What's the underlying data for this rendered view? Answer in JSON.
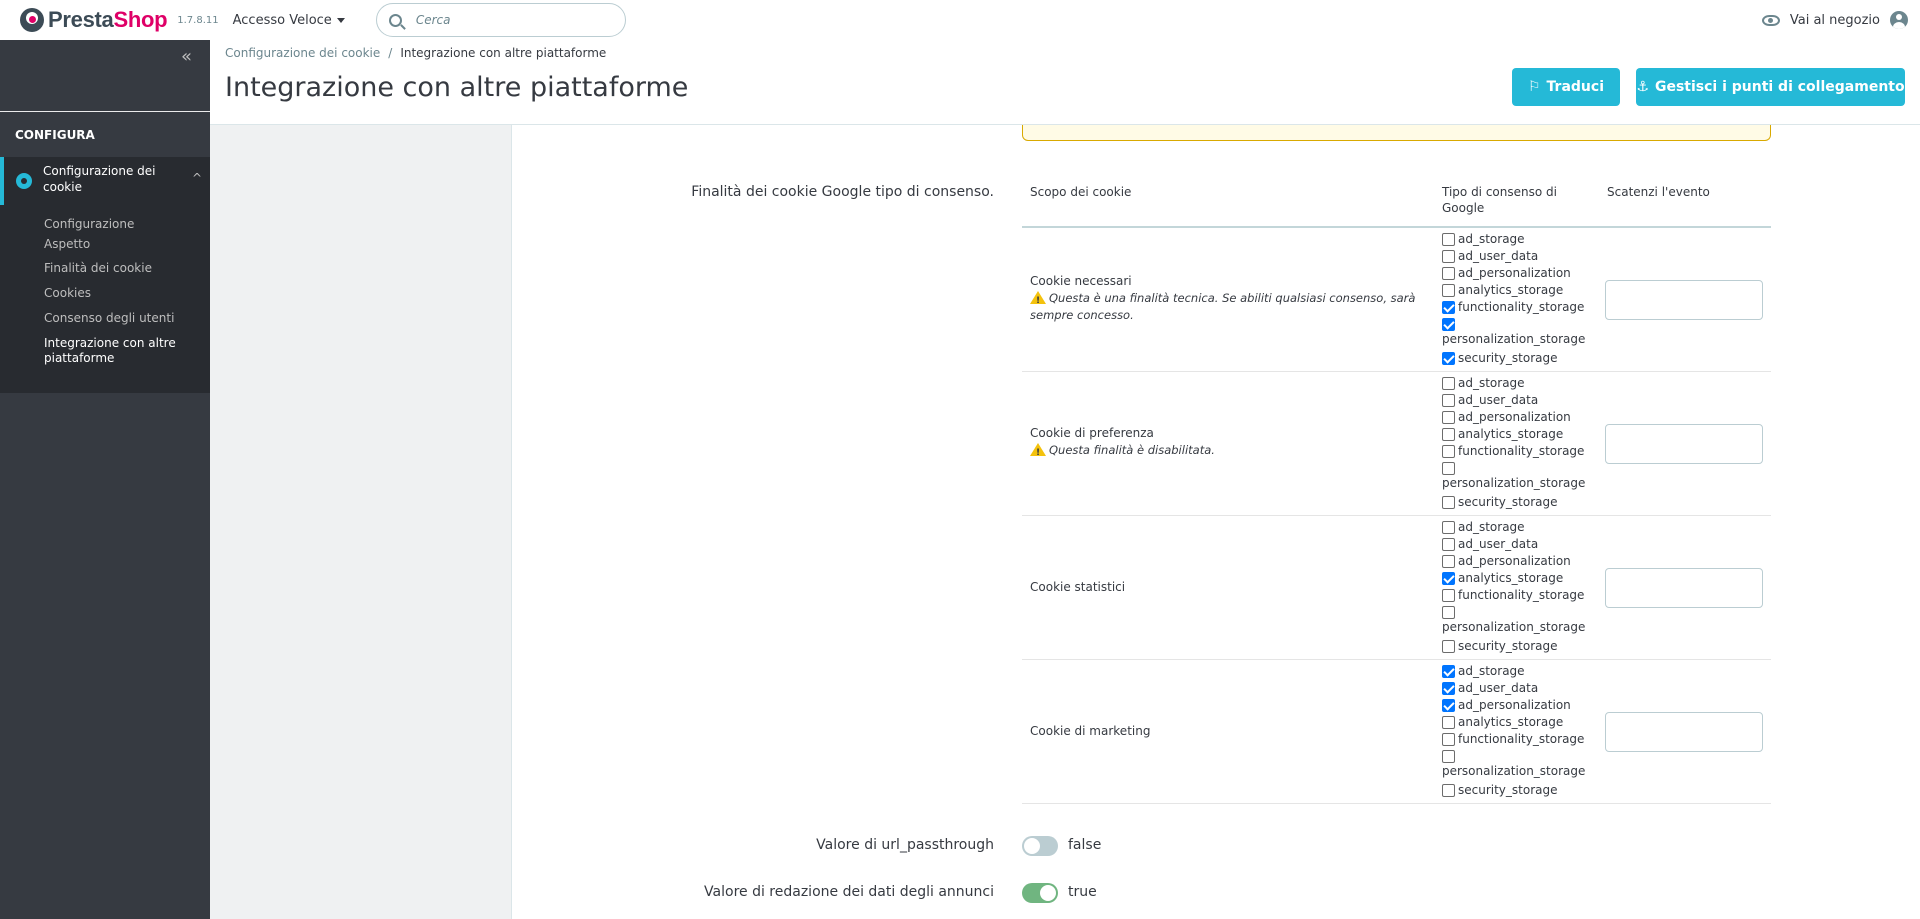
{
  "header": {
    "logo_presta": "Presta",
    "logo_shop": "Shop",
    "version": "1.7.8.11",
    "quick_access": "Accesso Veloce",
    "search_placeholder": "Cerca",
    "view_store": "Vai al negozio"
  },
  "sidebar": {
    "collapse_glyph": "«",
    "section": "CONFIGURA",
    "active_item": "Configurazione dei cookie",
    "chevron": "^",
    "sub_items": [
      "Configurazione",
      "Aspetto",
      "Finalità dei cookie",
      "Cookies",
      "Consenso degli utenti",
      "Integrazione con altre piattaforme"
    ]
  },
  "page": {
    "breadcrumb_parent": "Configurazione dei cookie",
    "breadcrumb_sep": "/",
    "breadcrumb_current": "Integrazione con altre piattaforme",
    "title": "Integrazione con altre piattaforme",
    "btn_translate": "Traduci",
    "btn_hooks": "Gestisci i punti di collegamento"
  },
  "form": {
    "google_label": "Finalità dei cookie Google tipo di consenso.",
    "table_headers": {
      "scope": "Scopo dei cookie",
      "consent_type": "Tipo di consenso di Google",
      "trigger": "Scatenzi l'evento"
    },
    "rows": [
      {
        "label": "Cookie necessari",
        "note": "Questa è una finalità tecnica. Se abiliti qualsiasi consenso, sarà sempre concesso.",
        "checks": [
          false,
          false,
          false,
          false,
          true,
          true,
          true
        ]
      },
      {
        "label": "Cookie di preferenza",
        "note": "Questa finalità è disabilitata.",
        "checks": [
          false,
          false,
          false,
          false,
          false,
          false,
          false
        ]
      },
      {
        "label": "Cookie statistici",
        "note": "",
        "checks": [
          false,
          false,
          false,
          true,
          false,
          false,
          false
        ]
      },
      {
        "label": "Cookie di marketing",
        "note": "",
        "checks": [
          true,
          true,
          true,
          false,
          false,
          false,
          false
        ]
      }
    ],
    "consent_types": [
      "ad_storage",
      "ad_user_data",
      "ad_personalization",
      "analytics_storage",
      "functionality_storage",
      "personalization_storage",
      "security_storage"
    ],
    "url_passthrough_label": "Valore di url_passthrough",
    "url_passthrough_value": "false",
    "ads_redaction_label": "Valore di redazione dei dati degli annunci",
    "ads_redaction_value": "true"
  },
  "colors": {
    "accent": "#25b9d7",
    "sidebar": "#363a41",
    "logo_pink": "#df0067",
    "switch_on": "#70b580",
    "switch_off": "#bbcdd2"
  }
}
